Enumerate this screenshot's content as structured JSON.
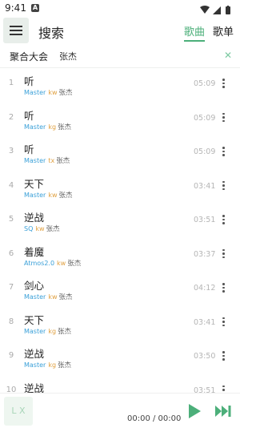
{
  "status": {
    "time": "9:41",
    "badge": "A"
  },
  "header": {
    "title": "搜索",
    "tabs": [
      "歌曲",
      "歌单"
    ]
  },
  "search": {
    "source": "聚合大会",
    "query": "张杰"
  },
  "songs": [
    {
      "index": "1",
      "name": "听",
      "quality": "Master",
      "source": "kw",
      "artist": "张杰",
      "duration": "05:09"
    },
    {
      "index": "2",
      "name": "听",
      "quality": "Master",
      "source": "kg",
      "artist": "张杰",
      "duration": "05:09"
    },
    {
      "index": "3",
      "name": "听",
      "quality": "Master",
      "source": "tx",
      "artist": "张杰",
      "duration": "05:09"
    },
    {
      "index": "4",
      "name": "天下",
      "quality": "Master",
      "source": "kw",
      "artist": "张杰",
      "duration": "03:41"
    },
    {
      "index": "5",
      "name": "逆战",
      "quality": "SQ",
      "source": "kw",
      "artist": "张杰",
      "duration": "03:51"
    },
    {
      "index": "6",
      "name": "着魔",
      "quality": "Atmos2.0",
      "source": "kw",
      "artist": "张杰",
      "duration": "03:37"
    },
    {
      "index": "7",
      "name": "剑心",
      "quality": "Master",
      "source": "kw",
      "artist": "张杰",
      "duration": "04:12"
    },
    {
      "index": "8",
      "name": "天下",
      "quality": "Master",
      "source": "kg",
      "artist": "张杰",
      "duration": "03:41"
    },
    {
      "index": "9",
      "name": "逆战",
      "quality": "Master",
      "source": "kg",
      "artist": "张杰",
      "duration": "03:50"
    },
    {
      "index": "10",
      "name": "逆战",
      "quality": "",
      "source": "",
      "artist": "",
      "duration": "03:51"
    }
  ],
  "player": {
    "cover_text": "L X",
    "time": "00:00 / 00:00"
  },
  "colors": {
    "accent": "#4caf7a",
    "quality": "#3aa0d8",
    "source": "#e0a040"
  },
  "icons": {
    "menu": "hamburger-icon",
    "clear": "close-icon",
    "more": "more-vert-icon",
    "play": "play-icon",
    "next": "skip-next-icon"
  }
}
